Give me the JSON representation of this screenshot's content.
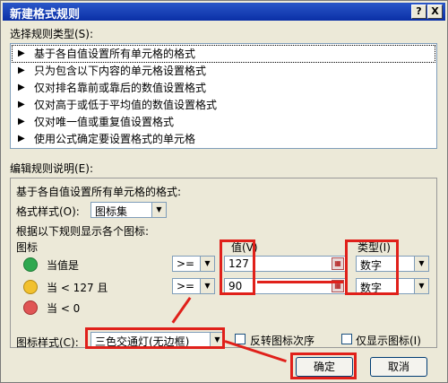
{
  "window": {
    "title": "新建格式规则",
    "help_button": "?",
    "close_button": "X"
  },
  "rule_type": {
    "label": "选择规则类型(S):",
    "items": [
      "基于各自值设置所有单元格的格式",
      "只为包含以下内容的单元格设置格式",
      "仅对排名靠前或靠后的数值设置格式",
      "仅对高于或低于平均值的数值设置格式",
      "仅对唯一值或重复值设置格式",
      "使用公式确定要设置格式的单元格"
    ],
    "selected_index": 0
  },
  "edit": {
    "label": "编辑规则说明(E):",
    "heading": "基于各自值设置所有单元格的格式:",
    "format_style_label": "格式样式(O):",
    "format_style_value": "图标集",
    "rule_caption": "根据以下规则显示各个图标:",
    "icon_header": "图标",
    "value_header": "值(V)",
    "type_header": "类型(I)",
    "rows": [
      {
        "icon": "green-circle",
        "color": "#2fa84f",
        "text": "当值是",
        "operator": ">=",
        "value": "127",
        "type": "数字"
      },
      {
        "icon": "yellow-circle",
        "color": "#f2c12e",
        "text": "当 < 127 且",
        "operator": ">=",
        "value": "90",
        "type": "数字"
      },
      {
        "icon": "red-circle",
        "color": "#e05555",
        "text": "当 < 0"
      }
    ],
    "icon_style_label": "图标样式(C):",
    "icon_style_value": "三色交通灯(无边框)",
    "reverse_label": "反转图标次序",
    "show_icon_only_label": "仅显示图标(I)"
  },
  "buttons": {
    "ok": "确定",
    "cancel": "取消"
  },
  "accent": {
    "annotation_red": "#e0201a",
    "title_blue": "#0a2fa6"
  }
}
